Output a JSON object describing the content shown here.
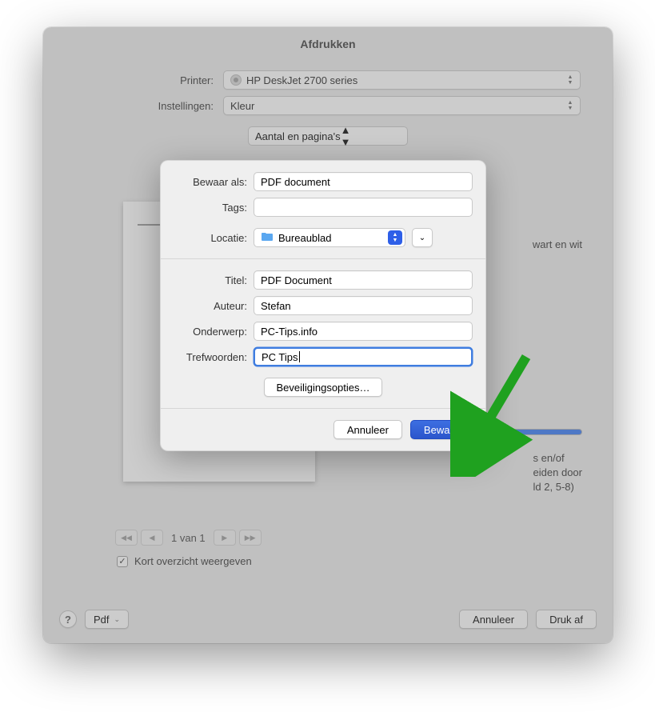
{
  "window": {
    "title": "Afdrukken",
    "printerLabel": "Printer:",
    "printerValue": "HP DeskJet 2700 series",
    "settingsLabel": "Instellingen:",
    "settingsValue": "Kleur",
    "midPopup": "Aantal en pagina's",
    "bwText": "wart en wit",
    "rangeText1": "s en/of",
    "rangeText2": "eiden door",
    "rangeText3": "ld 2, 5-8)",
    "pagerText": "1 van 1",
    "checkboxLabel": "Kort overzicht weergeven",
    "helpLabel": "?",
    "pdfLabel": "Pdf",
    "cancelLabel": "Annuleer",
    "printLabel": "Druk af"
  },
  "sheet": {
    "saveAsLabel": "Bewaar als:",
    "saveAsValue": "PDF document",
    "tagsLabel": "Tags:",
    "tagsValue": "",
    "locationLabel": "Locatie:",
    "locationValue": "Bureaublad",
    "titleLabel": "Titel:",
    "titleValue": "PDF Document",
    "authorLabel": "Auteur:",
    "authorValue": "Stefan",
    "subjectLabel": "Onderwerp:",
    "subjectValue": "PC-Tips.info",
    "keywordsLabel": "Trefwoorden:",
    "keywordsValue": "PC Tips",
    "securityLabel": "Beveiligingsopties…",
    "cancelLabel": "Annuleer",
    "saveLabel": "Bewaar"
  }
}
